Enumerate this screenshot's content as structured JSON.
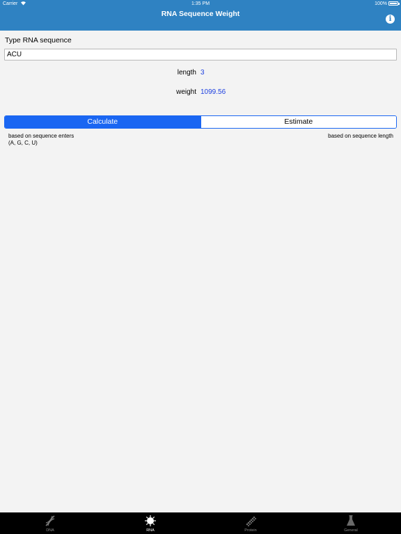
{
  "status_bar": {
    "carrier": "Carrier",
    "time": "1:35 PM",
    "battery": "100%"
  },
  "nav": {
    "title": "RNA Sequence Weight",
    "info_icon": "info-icon"
  },
  "input": {
    "label": "Type RNA sequence",
    "value": "ACU"
  },
  "results": {
    "length_label": "length",
    "length_value": "3",
    "weight_label": "weight",
    "weight_value": "1099.56"
  },
  "mode_selector": {
    "options": [
      "Calculate",
      "Estimate"
    ],
    "selected": "Calculate",
    "left_note": "based on sequence enters (A, G, C, U)",
    "right_note": "based on sequence length"
  },
  "tabs": [
    {
      "label": "DNA",
      "icon": "dna-helix-icon",
      "active": false
    },
    {
      "label": "RNA",
      "icon": "rna-icon",
      "active": true
    },
    {
      "label": "Protein",
      "icon": "protein-chain-icon",
      "active": false
    },
    {
      "label": "General",
      "icon": "flask-icon",
      "active": false
    }
  ],
  "colors": {
    "nav_background": "#2f82c2",
    "accent": "#1a66f2",
    "value_text": "#1c3fe0",
    "tabbar_background": "#000000"
  }
}
